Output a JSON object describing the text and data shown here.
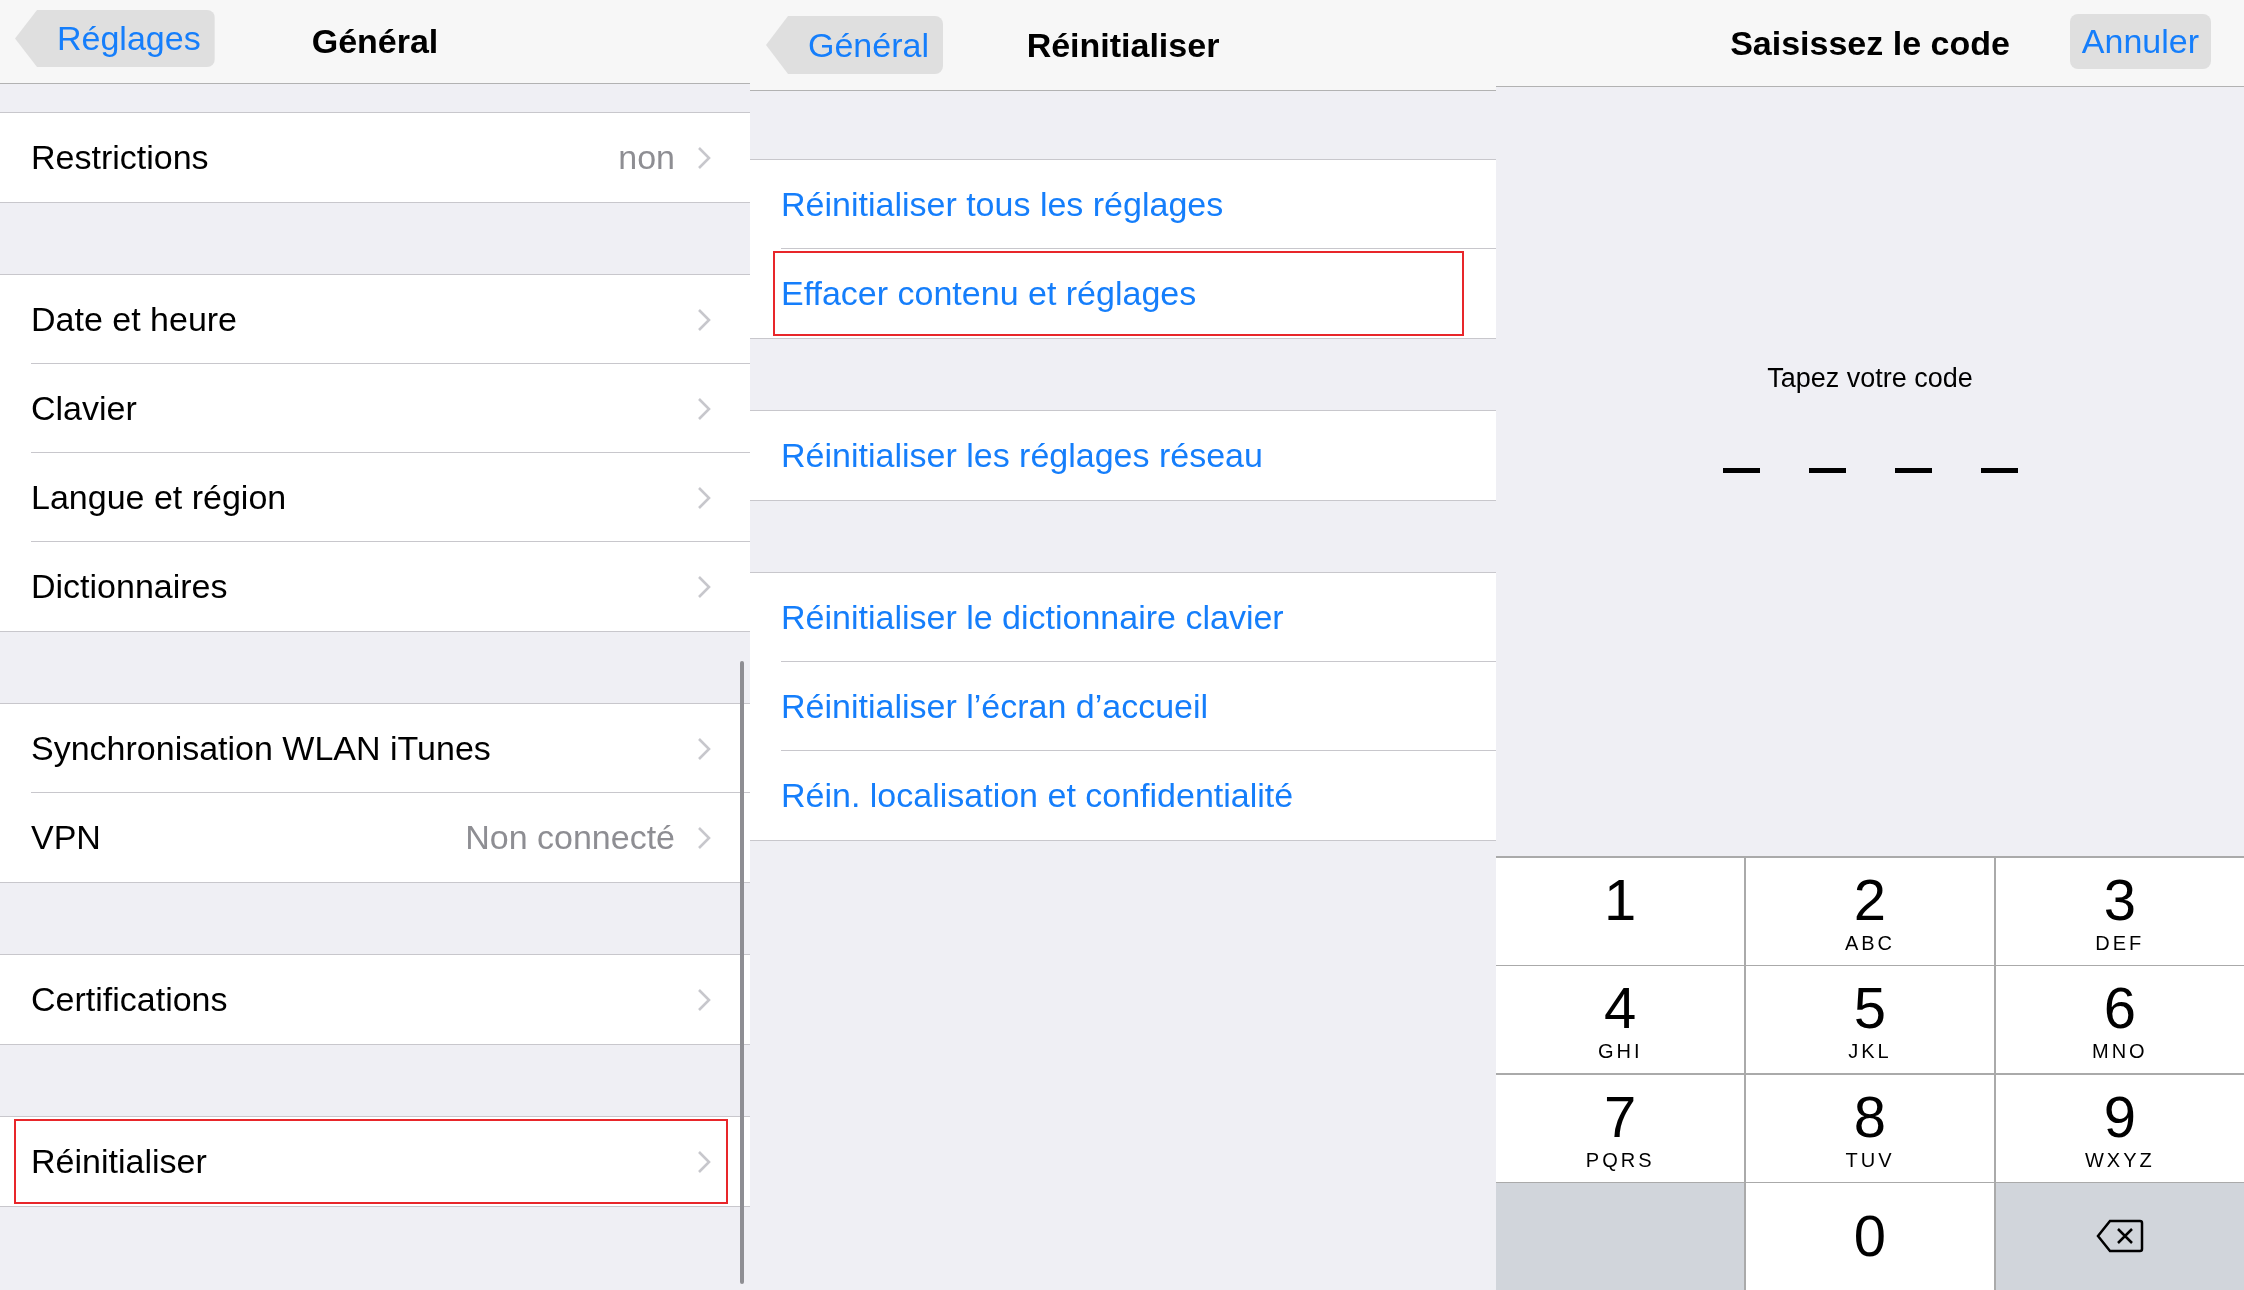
{
  "panels": [
    {
      "kind": "settings",
      "back_button": "Réglages",
      "title": "Général",
      "groups": [
        [
          {
            "label": "Restrictions",
            "value": "non",
            "highlighted": false
          }
        ],
        [
          {
            "label": "Date et heure",
            "highlighted": false
          },
          {
            "label": "Clavier",
            "highlighted": false
          },
          {
            "label": "Langue et région",
            "highlighted": false
          },
          {
            "label": "Dictionnaires",
            "highlighted": false
          }
        ],
        [
          {
            "label": "Synchronisation WLAN iTunes",
            "highlighted": false
          },
          {
            "label": "VPN",
            "value": "Non connecté",
            "highlighted": false
          }
        ],
        [
          {
            "label": "Certifications",
            "highlighted": false
          }
        ],
        [
          {
            "label": "Réinitialiser",
            "highlighted": true
          }
        ]
      ]
    },
    {
      "kind": "actions",
      "back_button": "Général",
      "title": "Réinitialiser",
      "groups": [
        [
          {
            "label": "Réinitialiser tous les réglages",
            "highlighted": false
          },
          {
            "label": "Effacer contenu et réglages",
            "highlighted": true
          }
        ],
        [
          {
            "label": "Réinitialiser les réglages réseau",
            "highlighted": false
          }
        ],
        [
          {
            "label": "Réinitialiser le dictionnaire clavier",
            "highlighted": false
          },
          {
            "label": "Réinitialiser l’écran d’accueil",
            "highlighted": false
          },
          {
            "label": "Réin. localisation et confidentialité",
            "highlighted": false
          }
        ]
      ]
    },
    {
      "kind": "passcode",
      "title": "Saisissez le code",
      "cancel_button": "Annuler",
      "prompt": "Tapez votre code",
      "code_slots": [
        {
          "filled": false
        },
        {
          "filled": false
        },
        {
          "filled": false
        },
        {
          "filled": false
        }
      ],
      "keys": [
        {
          "kind": "digit",
          "digit": "1"
        },
        {
          "kind": "digit",
          "digit": "2",
          "letters": "ABC"
        },
        {
          "kind": "digit",
          "digit": "3",
          "letters": "DEF"
        },
        {
          "kind": "digit",
          "digit": "4",
          "letters": "GHI"
        },
        {
          "kind": "digit",
          "digit": "5",
          "letters": "JKL"
        },
        {
          "kind": "digit",
          "digit": "6",
          "letters": "MNO"
        },
        {
          "kind": "digit",
          "digit": "7",
          "letters": "PQRS"
        },
        {
          "kind": "digit",
          "digit": "8",
          "letters": "TUV"
        },
        {
          "kind": "digit",
          "digit": "9",
          "letters": "WXYZ"
        },
        {
          "kind": "blank"
        },
        {
          "kind": "digit",
          "digit": "0"
        },
        {
          "kind": "delete"
        }
      ]
    }
  ]
}
